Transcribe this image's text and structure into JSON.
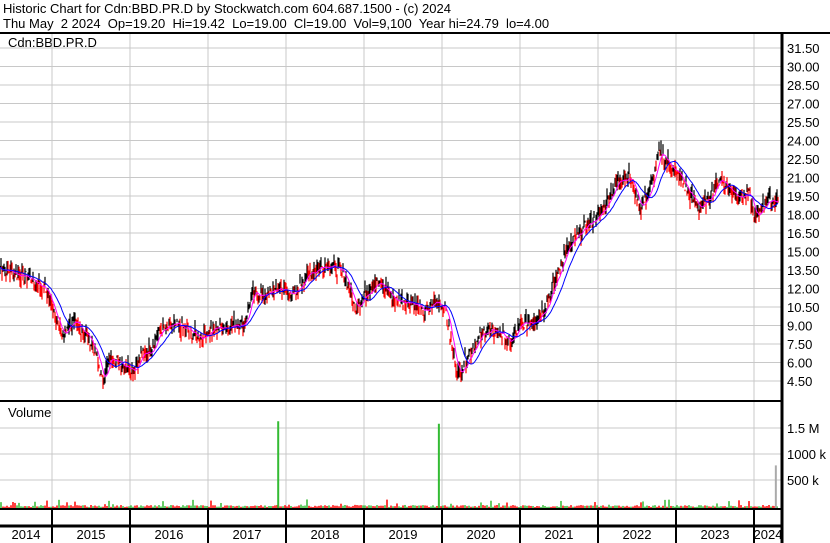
{
  "header": {
    "title": "Historic Chart for Cdn:BBD.PR.D by Stockwatch.com 604.687.1500 - (c) 2024",
    "quote": "Thu May  2 2024  Op=19.20  Hi=19.42  Lo=19.00  Cl=19.00  Vol=9,100  Year hi=24.79  lo=4.00"
  },
  "colors": {
    "price": "#000000",
    "down": "#ff0000",
    "ma_fast": "#ff00ff",
    "ma_slow": "#0000ff",
    "vol_up": "#33bb33",
    "vol_down": "#ff0000",
    "grid": "#c8c8c8"
  },
  "chart_data": [
    {
      "type": "line",
      "title": "Cdn:BBD.PR.D",
      "ylim": [
        3.5,
        32.5
      ],
      "y_ticks": [
        "31.50",
        "30.00",
        "28.50",
        "27.00",
        "25.50",
        "24.00",
        "22.50",
        "21.00",
        "19.50",
        "18.00",
        "16.50",
        "15.00",
        "13.50",
        "12.00",
        "10.50",
        "9.00",
        "7.50",
        "6.00",
        "4.50"
      ],
      "x_ticks": [
        "2014",
        "2015",
        "2016",
        "2017",
        "2018",
        "2019",
        "2020",
        "2021",
        "2022",
        "2023",
        "2024"
      ],
      "series": [
        {
          "name": "Close",
          "points": [
            [
              2014.33,
              13.7
            ],
            [
              2014.72,
              12.8
            ],
            [
              2014.91,
              12.0
            ],
            [
              2015.04,
              10.0
            ],
            [
              2015.13,
              8.0
            ],
            [
              2015.23,
              9.3
            ],
            [
              2015.42,
              8.5
            ],
            [
              2015.55,
              7.0
            ],
            [
              2015.65,
              4.4
            ],
            [
              2015.74,
              6.5
            ],
            [
              2015.94,
              5.8
            ],
            [
              2016.06,
              5.5
            ],
            [
              2016.13,
              6.5
            ],
            [
              2016.26,
              7.0
            ],
            [
              2016.38,
              8.5
            ],
            [
              2016.58,
              9.0
            ],
            [
              2016.77,
              8.5
            ],
            [
              2016.9,
              8.0
            ],
            [
              2017.09,
              8.8
            ],
            [
              2017.28,
              9.0
            ],
            [
              2017.47,
              9.2
            ],
            [
              2017.56,
              11.5
            ],
            [
              2017.73,
              11.5
            ],
            [
              2017.92,
              12.0
            ],
            [
              2018.12,
              11.5
            ],
            [
              2018.24,
              13.0
            ],
            [
              2018.44,
              13.8
            ],
            [
              2018.56,
              14.0
            ],
            [
              2018.76,
              13.0
            ],
            [
              2018.88,
              10.5
            ],
            [
              2018.95,
              11.0
            ],
            [
              2019.14,
              12.5
            ],
            [
              2019.27,
              12.0
            ],
            [
              2019.4,
              11.0
            ],
            [
              2019.59,
              11.0
            ],
            [
              2019.78,
              10.0
            ],
            [
              2019.91,
              11.0
            ],
            [
              2020.04,
              10.5
            ],
            [
              2020.13,
              7.0
            ],
            [
              2020.21,
              5.0
            ],
            [
              2020.29,
              6.0
            ],
            [
              2020.42,
              7.5
            ],
            [
              2020.55,
              8.5
            ],
            [
              2020.74,
              8.5
            ],
            [
              2020.87,
              7.5
            ],
            [
              2021.0,
              9.0
            ],
            [
              2021.19,
              9.5
            ],
            [
              2021.32,
              10.5
            ],
            [
              2021.45,
              12.5
            ],
            [
              2021.58,
              15.0
            ],
            [
              2021.71,
              16.0
            ],
            [
              2021.83,
              17.0
            ],
            [
              2022.03,
              18.0
            ],
            [
              2022.15,
              19.5
            ],
            [
              2022.28,
              21.0
            ],
            [
              2022.41,
              21.0
            ],
            [
              2022.54,
              18.5
            ],
            [
              2022.67,
              20.0
            ],
            [
              2022.79,
              23.0
            ],
            [
              2022.86,
              22.5
            ],
            [
              2022.92,
              22.0
            ],
            [
              2023.05,
              21.0
            ],
            [
              2023.18,
              19.5
            ],
            [
              2023.31,
              18.5
            ],
            [
              2023.44,
              19.5
            ],
            [
              2023.56,
              21.0
            ],
            [
              2023.69,
              20.0
            ],
            [
              2023.82,
              19.5
            ],
            [
              2023.95,
              19.5
            ],
            [
              2024.01,
              17.5
            ],
            [
              2024.14,
              19.0
            ],
            [
              2024.27,
              19.2
            ],
            [
              2024.33,
              19.0
            ]
          ]
        }
      ]
    },
    {
      "type": "bar",
      "title": "Volume",
      "y_ticks": [
        "1.5 M",
        "1000 k",
        "500 k"
      ],
      "ylim": [
        0,
        1800000
      ],
      "spikes": [
        [
          2017.9,
          1650000,
          "up"
        ],
        [
          2019.96,
          1600000,
          "up"
        ],
        [
          2024.28,
          800000,
          "flat"
        ]
      ]
    }
  ]
}
